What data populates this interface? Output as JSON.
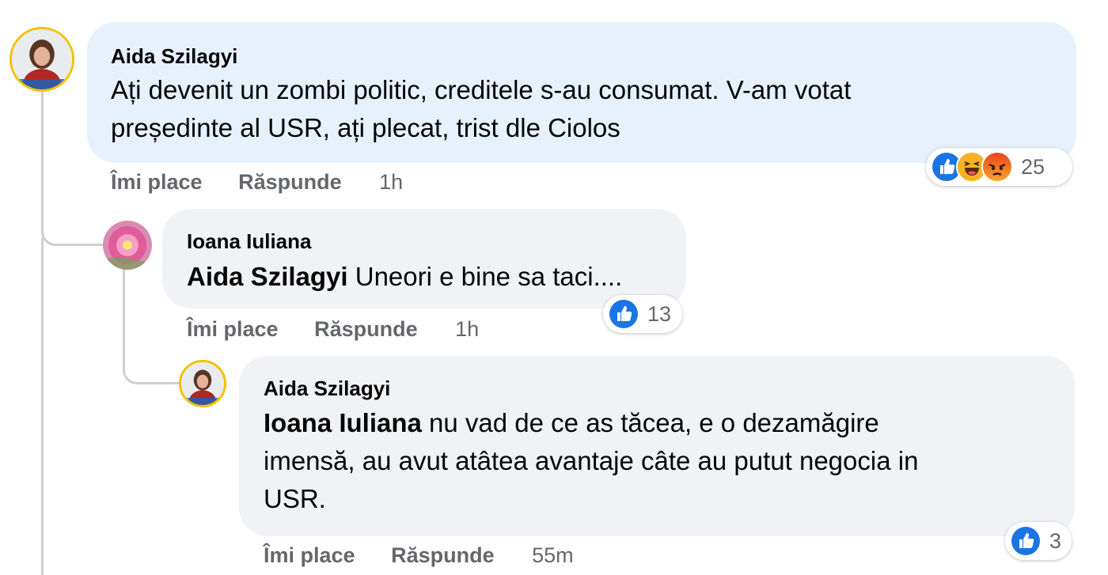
{
  "comments": [
    {
      "author": "Aida Szilagyi",
      "text_line1": "Ați devenit un zombi politic, creditele s-au consumat. V-am votat",
      "text_line2": "președinte al USR, ați plecat, trist dle Ciolos",
      "like_label": "Îmi place",
      "reply_label": "Răspunde",
      "time": "1h",
      "reaction_count": "25",
      "reactions": [
        "like-icon",
        "haha-icon",
        "angry-icon"
      ]
    },
    {
      "author": "Ioana Iuliana",
      "mention": "Aida Szilagyi",
      "text": " Uneori e bine sa taci....",
      "like_label": "Îmi place",
      "reply_label": "Răspunde",
      "time": "1h",
      "reaction_count": "13",
      "reactions": [
        "like-icon"
      ]
    },
    {
      "author": "Aida Szilagyi",
      "mention": "Ioana Iuliana",
      "text_line1": " nu vad de ce as tăcea, e o dezamăgire",
      "text_line2": "imensă, au avut atâtea avantaje câte au putut negocia in",
      "text_line3": "USR.",
      "like_label": "Îmi place",
      "reply_label": "Răspunde",
      "time": "55m",
      "reaction_count": "3",
      "reactions": [
        "like-icon"
      ]
    }
  ],
  "colors": {
    "bubble_highlight": "#e7f1fb",
    "bubble": "#f0f2f5",
    "like_blue": "#1b74e4",
    "secondary_text": "#65676b"
  }
}
